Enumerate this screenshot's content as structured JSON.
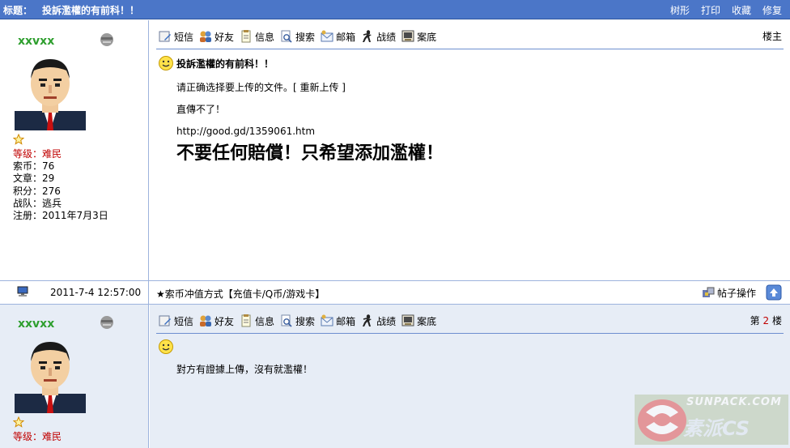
{
  "titlebar": {
    "label": "标题：",
    "text": "投訴濫權的有前科！！",
    "actions": [
      "树形",
      "打印",
      "收藏",
      "修复"
    ]
  },
  "toolbar": {
    "items": [
      {
        "label": "短信",
        "icon": "message-icon"
      },
      {
        "label": "好友",
        "icon": "friends-icon"
      },
      {
        "label": "信息",
        "icon": "info-icon"
      },
      {
        "label": "搜索",
        "icon": "search-icon"
      },
      {
        "label": "邮箱",
        "icon": "mail-icon"
      },
      {
        "label": "战绩",
        "icon": "soldier-icon"
      },
      {
        "label": "案底",
        "icon": "record-icon"
      }
    ]
  },
  "posts": [
    {
      "username": "xxvxx",
      "level": "等级：难民",
      "stats": [
        "索币：76",
        "文章：29",
        "积分：276",
        "战队：逃兵",
        "注册：2011年7月3日"
      ],
      "floor": "楼主",
      "title": "投訴濫權的有前科！！",
      "body": [
        "请正确选择要上传的文件。[ 重新上传 ]",
        "直傳不了！",
        "http://good.gd/1359061.htm"
      ],
      "big": "不要任何賠償！只希望添加濫權！"
    },
    {
      "username": "xxvxx",
      "level": "等级：难民",
      "floor_prefix": "第",
      "floor_num": "2",
      "floor_suffix": "楼",
      "body": [
        "對方有證據上傳，沒有就濫權！"
      ]
    }
  ],
  "footer": {
    "date": "2011-7-4 12:57:00",
    "ad": "★索币冲值方式【充值卡/Q币/游戏卡】",
    "ops": "帖子操作"
  },
  "watermark": {
    "text": "SUNPACK.COM",
    "cn": "素派CS"
  },
  "colors": {
    "titlebar": "#4b76c8",
    "username": "#2f9f2f",
    "level": "#c00000",
    "divider": "#6e8fd0"
  }
}
